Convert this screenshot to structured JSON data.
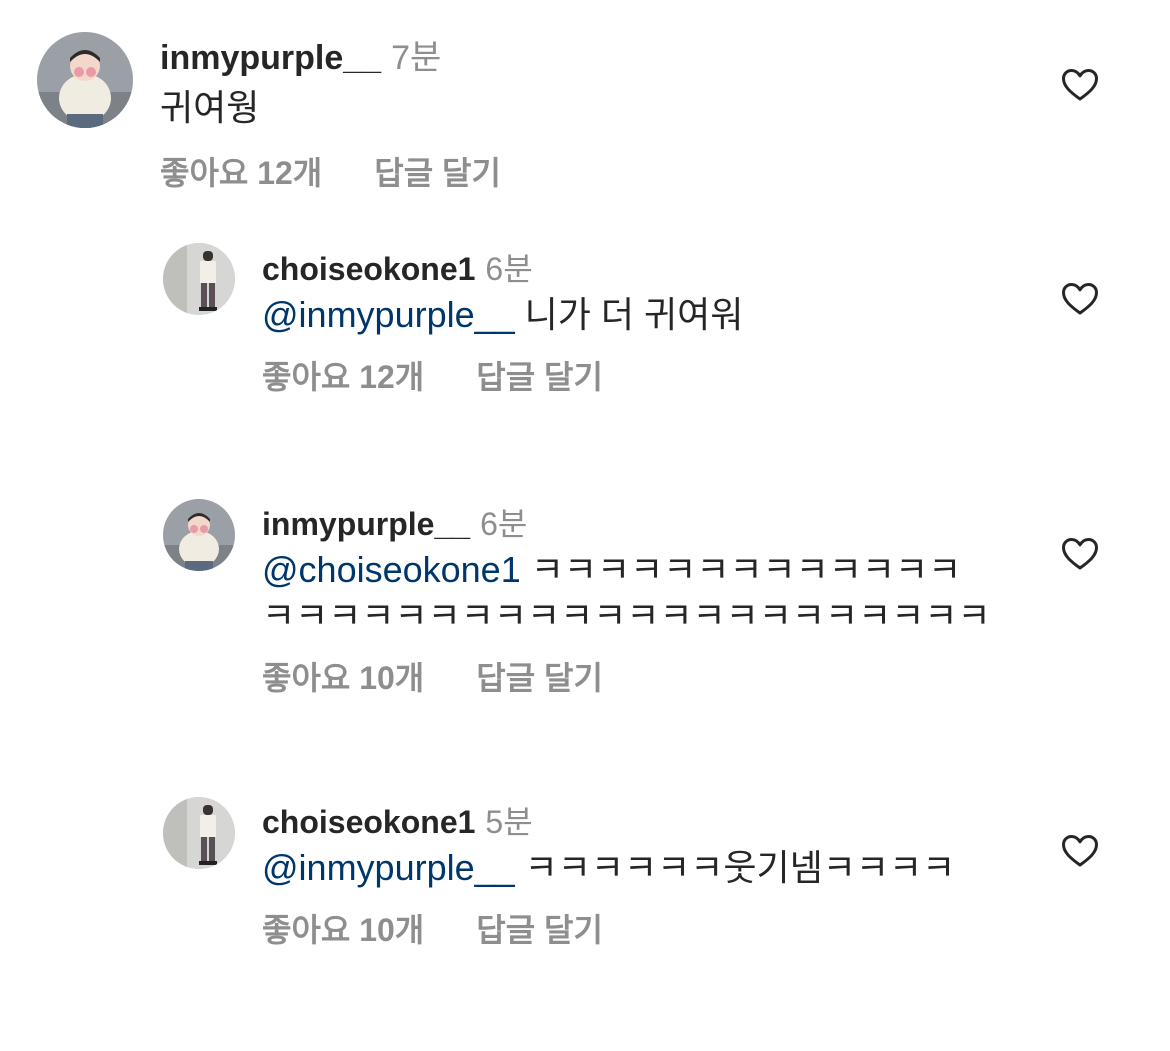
{
  "comments": [
    {
      "username": "inmypurple__",
      "time": "7분",
      "mention": "",
      "text": "귀여웡",
      "likes": "좋아요 12개",
      "reply": "답글 달기",
      "avatar_icon": "profile-photo-inmypurple"
    },
    {
      "username": "choiseokone1",
      "time": "6분",
      "mention": "@inmypurple__",
      "text": " 니가 더 귀여워",
      "likes": "좋아요 12개",
      "reply": "답글 달기",
      "avatar_icon": "profile-photo-choiseokone1"
    },
    {
      "username": "inmypurple__",
      "time": "6분",
      "mention": "@choiseokone1",
      "text": " ㅋㅋㅋㅋㅋㅋㅋㅋㅋㅋㅋㅋㅋㅋㅋㅋㅋㅋㅋㅋㅋㅋㅋㅋㅋㅋㅋㅋㅋㅋㅋㅋㅋㅋㅋ",
      "likes": "좋아요 10개",
      "reply": "답글 달기",
      "avatar_icon": "profile-photo-inmypurple"
    },
    {
      "username": "choiseokone1",
      "time": "5분",
      "mention": "@inmypurple__",
      "text": " ㅋㅋㅋㅋㅋㅋ웃기넴ㅋㅋㅋㅋ",
      "likes": "좋아요 10개",
      "reply": "답글 달기",
      "avatar_icon": "profile-photo-choiseokone1"
    }
  ],
  "icons": {
    "like": "heart-outline-icon"
  },
  "colors": {
    "text": "#262626",
    "secondary": "#8e8e8e",
    "mention": "#00376b"
  }
}
